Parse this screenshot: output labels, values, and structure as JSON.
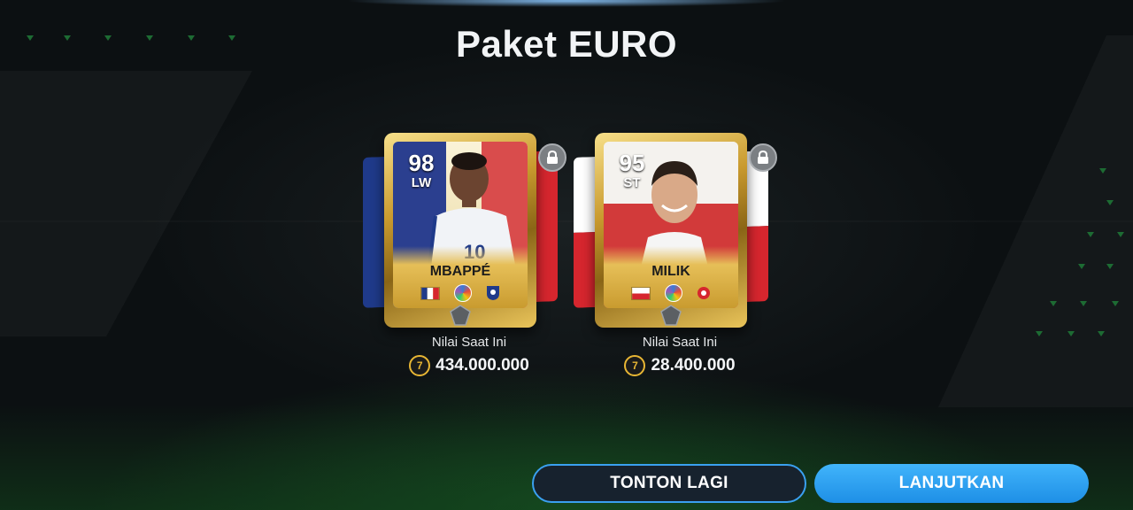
{
  "title": "Paket EURO",
  "cards": [
    {
      "rating": "98",
      "position": "LW",
      "name": "MBAPPÉ",
      "country": "France",
      "value_label": "Nilai Saat Ini",
      "value": "434.000.000",
      "locked": true,
      "flag_colors": [
        "#1f3a8a",
        "#ffffff",
        "#d6262e"
      ]
    },
    {
      "rating": "95",
      "position": "ST",
      "name": "MILIK",
      "country": "Poland",
      "value_label": "Nilai Saat Ini",
      "value": "28.400.000",
      "locked": true,
      "flag_colors": [
        "#ffffff",
        "#d6262e"
      ]
    }
  ],
  "coin_icon": "fc-coin-icon",
  "lock_icon": "lock-icon",
  "buttons": {
    "replay": "TONTON LAGI",
    "continue": "LANJUTKAN"
  },
  "colors": {
    "accent_blue": "#2ea3f2",
    "gold": "#e8b634",
    "background": "#0c1012"
  }
}
